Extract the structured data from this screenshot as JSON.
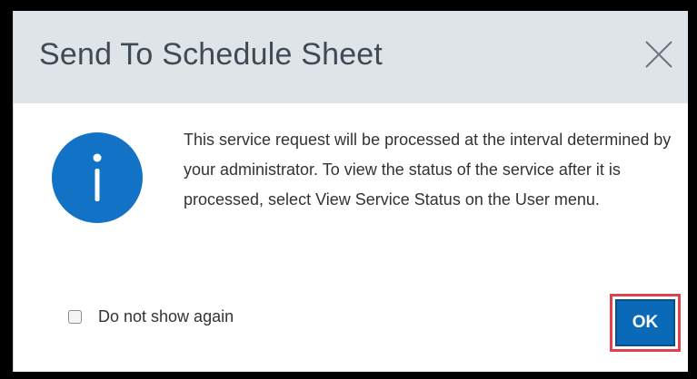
{
  "dialog": {
    "title": "Send To Schedule Sheet",
    "close_icon": "close-icon",
    "info_icon": "info-icon",
    "message": "This service request will be processed at the interval determined by your administrator. To view the status of the service after it is processed, select View Service Status on the User menu.",
    "checkbox": {
      "label": "Do not show again",
      "checked": false
    },
    "ok_label": "OK"
  },
  "colors": {
    "header_bg": "#dfe4e8",
    "info_icon": "#1272c6",
    "button_primary": "#0a6ab8",
    "highlight": "#e0414f"
  }
}
